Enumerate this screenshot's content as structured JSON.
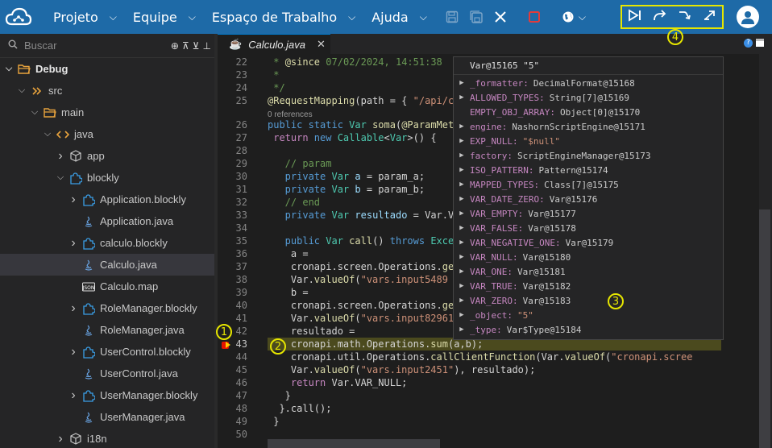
{
  "topbar": {
    "menus": [
      {
        "label": "Projeto"
      },
      {
        "label": "Equipe"
      },
      {
        "label": "Espaço de Trabalho"
      },
      {
        "label": "Ajuda"
      }
    ],
    "accent": "#1e6aa7",
    "highlight": "#e6e600"
  },
  "sidebar": {
    "search_placeholder": "Buscar",
    "tree": [
      {
        "label": "Debug",
        "icon": "folder-open-icon",
        "arrow": "down",
        "indent": 0,
        "bold": true
      },
      {
        "label": "src",
        "icon": "source-icon",
        "arrow": "down",
        "indent": 1
      },
      {
        "label": "main",
        "icon": "folder-open-icon",
        "arrow": "down",
        "indent": 2
      },
      {
        "label": "java",
        "icon": "code-icon",
        "arrow": "down",
        "indent": 3
      },
      {
        "label": "app",
        "icon": "package-icon",
        "arrow": "right",
        "indent": 4
      },
      {
        "label": "blockly",
        "icon": "puzzle-icon",
        "arrow": "down",
        "indent": 4
      },
      {
        "label": "Application.blockly",
        "icon": "puzzle-icon",
        "arrow": "right",
        "indent": 5
      },
      {
        "label": "Application.java",
        "icon": "java-icon",
        "arrow": "",
        "indent": 5
      },
      {
        "label": "calculo.blockly",
        "icon": "puzzle-icon",
        "arrow": "right",
        "indent": 5
      },
      {
        "label": "Calculo.java",
        "icon": "java-icon",
        "arrow": "",
        "indent": 5,
        "selected": true
      },
      {
        "label": "Calculo.map",
        "icon": "json-icon",
        "arrow": "",
        "indent": 5
      },
      {
        "label": "RoleManager.blockly",
        "icon": "puzzle-icon",
        "arrow": "right",
        "indent": 5
      },
      {
        "label": "RoleManager.java",
        "icon": "java-icon",
        "arrow": "",
        "indent": 5
      },
      {
        "label": "UserControl.blockly",
        "icon": "puzzle-icon",
        "arrow": "right",
        "indent": 5
      },
      {
        "label": "UserControl.java",
        "icon": "java-icon",
        "arrow": "",
        "indent": 5
      },
      {
        "label": "UserManager.blockly",
        "icon": "puzzle-icon",
        "arrow": "right",
        "indent": 5
      },
      {
        "label": "UserManager.java",
        "icon": "java-icon",
        "arrow": "",
        "indent": 5
      },
      {
        "label": "i18n",
        "icon": "package-icon",
        "arrow": "right",
        "indent": 4
      }
    ]
  },
  "editor": {
    "tab_label": "Calculo.java",
    "references_label": "0 references",
    "lines": [
      {
        "n": "22",
        "html": "<span class='cm'> * </span><span class='an'>@since</span><span class='cm'> 07/02/2024, 14:51:38</span>"
      },
      {
        "n": "23",
        "html": "<span class='cm'> *</span>"
      },
      {
        "n": "24",
        "html": "<span class='cm'> */</span>"
      },
      {
        "n": "25",
        "html": "<span class='an'>@RequestMapping</span><span class='plain'>(path = { </span><span class='str'>\"/api/c</span>"
      },
      {
        "n": "",
        "html": "<span class='meta-line'>0 references</span>",
        "meta": true
      },
      {
        "n": "26",
        "html": "<span class='kw'>public static </span><span class='ty'>Var</span><span class='fn'> soma</span><span class='plain'>(</span><span class='an'>@ParamMet</span>"
      },
      {
        "n": "27",
        "html": "<span class='kw2'> return </span><span class='kw'>new </span><span class='ty'>Callable</span><span class='plain'>&lt;</span><span class='ty'>Var</span><span class='plain'>&gt;() {</span>"
      },
      {
        "n": "28",
        "html": ""
      },
      {
        "n": "29",
        "html": "<span class='cm'>   // param</span>"
      },
      {
        "n": "30",
        "html": "<span class='kw'>   private </span><span class='ty'>Var</span><span class='var'> a</span><span class='plain'> = param_a;</span>"
      },
      {
        "n": "31",
        "html": "<span class='kw'>   private </span><span class='ty'>Var</span><span class='var'> b</span><span class='plain'> = param_b;</span>"
      },
      {
        "n": "32",
        "html": "<span class='cm'>   // end</span>"
      },
      {
        "n": "33",
        "html": "<span class='kw'>   private </span><span class='ty'>Var</span><span class='var'> resultado</span><span class='plain'> = Var.V</span>"
      },
      {
        "n": "34",
        "html": ""
      },
      {
        "n": "35",
        "html": "<span class='kw'>   public </span><span class='ty'>Var</span><span class='fn'> call</span><span class='plain'>() </span><span class='kw'>throws </span><span class='ty'>Exce</span>"
      },
      {
        "n": "36",
        "html": "<span class='plain'>    a =</span>"
      },
      {
        "n": "37",
        "html": "<span class='plain'>    cronapi.screen.Operations.</span><span class='fn'>ge</span>"
      },
      {
        "n": "38",
        "html": "<span class='plain'>    Var.</span><span class='fn'>valueOf</span><span class='plain'>(</span><span class='str'>\"vars.input5489</span>"
      },
      {
        "n": "39",
        "html": "<span class='plain'>    b =</span>"
      },
      {
        "n": "40",
        "html": "<span class='plain'>    cronapi.screen.Operations.</span><span class='fn'>ge</span>"
      },
      {
        "n": "41",
        "html": "<span class='plain'>    Var.</span><span class='fn'>valueOf</span><span class='plain'>(</span><span class='str'>\"vars.input82961</span>"
      },
      {
        "n": "42",
        "html": "<span class='plain'>    resultado =</span>"
      },
      {
        "n": "43",
        "html": "<span class='plain'>    cronapi.math.Operations.</span><span class='fn'>sum</span><span class='plain'>(a,b);</span>",
        "current": true
      },
      {
        "n": "44",
        "html": "<span class='plain'>    cronapi.util.Operations.</span><span class='fn'>callClientFunction</span><span class='plain'>(Var.</span><span class='fn'>valueOf</span><span class='plain'>(</span><span class='str'>\"cronapi.scree</span>"
      },
      {
        "n": "45",
        "html": "<span class='plain'>    Var.</span><span class='fn'>valueOf</span><span class='plain'>(</span><span class='str'>\"vars.input2451\"</span><span class='plain'>), resultado);</span>"
      },
      {
        "n": "46",
        "html": "<span class='kw2'>    return </span><span class='plain'>Var.VAR_NULL;</span>"
      },
      {
        "n": "47",
        "html": "<span class='plain'>   }</span>"
      },
      {
        "n": "48",
        "html": "<span class='plain'>  }.call();</span>"
      },
      {
        "n": "49",
        "html": "<span class='plain'> }</span>"
      },
      {
        "n": "50",
        "html": ""
      }
    ]
  },
  "popup": {
    "title": "Var@15165 \"5\"",
    "rows": [
      {
        "key": "_formatter:",
        "val": "DecimalFormat@15168",
        "arrow": true
      },
      {
        "key": "ALLOWED_TYPES:",
        "val": "String[7]@15169",
        "arrow": true
      },
      {
        "key": "EMPTY_OBJ_ARRAY:",
        "val": "Object[0]@15170",
        "arrow": false
      },
      {
        "key": "engine:",
        "val": "NashornScriptEngine@15171",
        "arrow": true
      },
      {
        "key": "EXP_NULL:",
        "val": "\"$null\"",
        "arrow": true,
        "str": true
      },
      {
        "key": "factory:",
        "val": "ScriptEngineManager@15173",
        "arrow": true
      },
      {
        "key": "ISO_PATTERN:",
        "val": "Pattern@15174",
        "arrow": true
      },
      {
        "key": "MAPPED_TYPES:",
        "val": "Class[7]@15175",
        "arrow": true
      },
      {
        "key": "VAR_DATE_ZERO:",
        "val": "Var@15176",
        "arrow": true
      },
      {
        "key": "VAR_EMPTY:",
        "val": "Var@15177",
        "arrow": true
      },
      {
        "key": "VAR_FALSE:",
        "val": "Var@15178",
        "arrow": true
      },
      {
        "key": "VAR_NEGATIVE_ONE:",
        "val": "Var@15179",
        "arrow": true
      },
      {
        "key": "VAR_NULL:",
        "val": "Var@15180",
        "arrow": true
      },
      {
        "key": "VAR_ONE:",
        "val": "Var@15181",
        "arrow": true
      },
      {
        "key": "VAR_TRUE:",
        "val": "Var@15182",
        "arrow": true
      },
      {
        "key": "VAR_ZERO:",
        "val": "Var@15183",
        "arrow": true
      },
      {
        "key": "_object:",
        "val": "\"5\"",
        "arrow": true,
        "str": true
      },
      {
        "key": "_type:",
        "val": "Var$Type@15184",
        "arrow": true
      }
    ]
  },
  "markers": [
    "1",
    "2",
    "3",
    "4"
  ]
}
